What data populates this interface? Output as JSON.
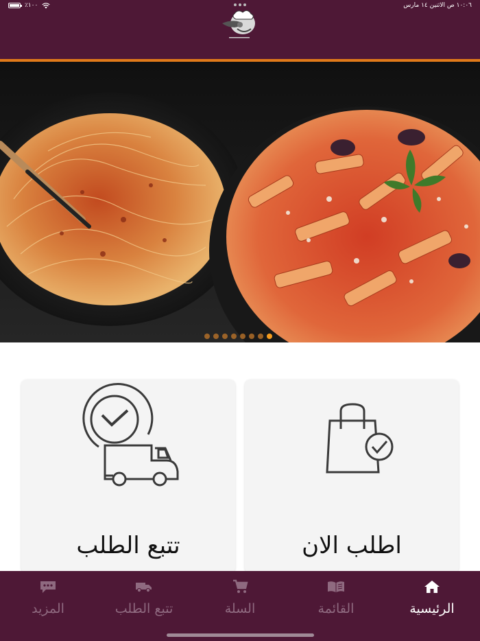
{
  "status_bar": {
    "time_date": "١٠:٠٦ ص   الاثنين ١٤ مارس",
    "battery": "٪١٠٠"
  },
  "banner": {
    "slides_count": 8,
    "active_slide_index": 7
  },
  "cards": {
    "track_order": {
      "label": "تتبع الطلب",
      "icon": "clock-delivery-truck-icon"
    },
    "order_now": {
      "label": "اطلب الان",
      "icon": "shopping-bag-check-icon"
    }
  },
  "bottom_nav": {
    "items": [
      {
        "label": "المزيد",
        "icon": "chat-dots-icon"
      },
      {
        "label": "تتبع الطلب",
        "icon": "truck-icon"
      },
      {
        "label": "السلة",
        "icon": "cart-icon"
      },
      {
        "label": "القائمة",
        "icon": "menu-book-icon"
      },
      {
        "label": "الرئيسية",
        "icon": "home-icon"
      }
    ],
    "active_index": 4
  },
  "colors": {
    "header_bg": "#4e1836",
    "accent_orange": "#e07a1a",
    "nav_inactive": "#8f6a80",
    "card_bg": "#f4f4f4"
  }
}
